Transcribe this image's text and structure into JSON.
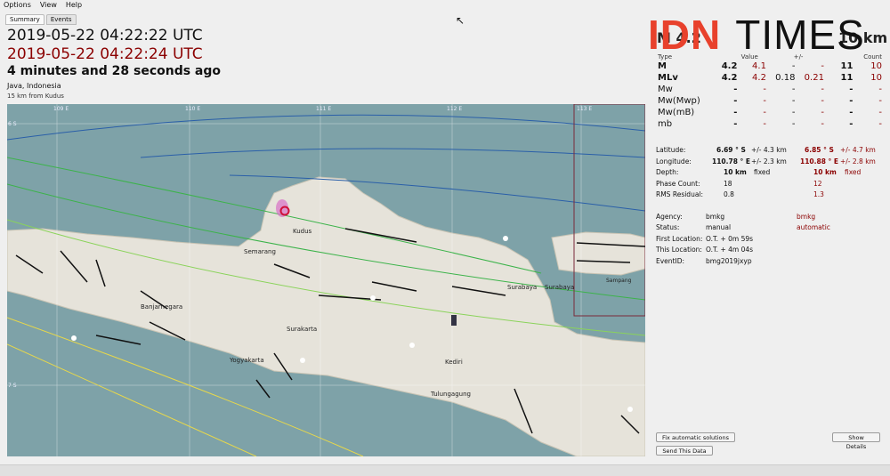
{
  "menu": [
    "Options",
    "View",
    "Help"
  ],
  "tabs": [
    "Summary",
    "Events"
  ],
  "origin_time": "2019-05-22 04:22:22 UTC",
  "current_time": "2019-05-22 04:22:24 UTC",
  "elapsed": "4 minutes and 28 seconds ago",
  "region": "Java, Indonesia",
  "nearest": "15 km from Kudus",
  "logo": {
    "idn": "IDN",
    "times": "TIMES"
  },
  "headline": {
    "mag_partial": "M 4.2",
    "depth_partial": "10 km"
  },
  "mag_table": {
    "headers": [
      "Type",
      "Value",
      "+/-",
      "Count"
    ],
    "rows": [
      {
        "type": "M",
        "value": "4.2",
        "value2": "4.1",
        "err": "-",
        "err2": "-",
        "count": "11",
        "count2": "10"
      },
      {
        "type": "MLv",
        "value": "4.2",
        "value2": "4.2",
        "err": "0.18",
        "err2": "0.21",
        "count": "11",
        "count2": "10"
      },
      {
        "type": "Mw",
        "value": "-",
        "value2": "-",
        "err": "-",
        "err2": "-",
        "count": "-",
        "count2": "-"
      },
      {
        "type": "Mw(Mwp)",
        "value": "-",
        "value2": "-",
        "err": "-",
        "err2": "-",
        "count": "-",
        "count2": "-"
      },
      {
        "type": "Mw(mB)",
        "value": "-",
        "value2": "-",
        "err": "-",
        "err2": "-",
        "count": "-",
        "count2": "-"
      },
      {
        "type": "mb",
        "value": "-",
        "value2": "-",
        "err": "-",
        "err2": "-",
        "count": "-",
        "count2": "-"
      }
    ]
  },
  "info": {
    "latitude": {
      "label": "Latitude:",
      "v1": "6.69 ° S",
      "e1": "+/- 4.3 km",
      "v2": "6.85 ° S",
      "e2": "+/- 4.7 km"
    },
    "longitude": {
      "label": "Longitude:",
      "v1": "110.78 ° E",
      "e1": "+/- 2.3 km",
      "v2": "110.88 ° E",
      "e2": "+/- 2.8 km"
    },
    "depth": {
      "label": "Depth:",
      "v1": "10 km",
      "e1": "fixed",
      "v2": "10 km",
      "e2": "fixed"
    },
    "phase_count": {
      "label": "Phase Count:",
      "v1": "18",
      "v2": "12"
    },
    "rms": {
      "label": "RMS Residual:",
      "v1": "0.8",
      "v2": "1.3"
    },
    "agency": {
      "label": "Agency:",
      "v1": "bmkg",
      "v2": "bmkg"
    },
    "status": {
      "label": "Status:",
      "v1": "manual",
      "v2": "automatic"
    },
    "first_location": {
      "label": "First Location:",
      "v1": "O.T. + 0m 59s"
    },
    "this_location": {
      "label": "This Location:",
      "v1": "O.T. + 4m 04s"
    },
    "event_id": {
      "label": "EventID:",
      "v1": "bmg2019jxyp"
    }
  },
  "buttons": {
    "fix": "Fix automatic solutions",
    "show": "Show Details",
    "send": "Send This Data"
  },
  "map": {
    "lon_labels": [
      "109 E",
      "110 E",
      "111 E",
      "112 E",
      "113 E"
    ],
    "lat_labels": [
      "6 S",
      "7 S"
    ],
    "cities": [
      "Kudus",
      "Semarang",
      "Banjarnegara",
      "Surakarta",
      "Yogyakarta",
      "Kediri",
      "Tulungagung",
      "Surabaya",
      "Surabaya",
      "Sampang"
    ],
    "colors": {
      "sea": "#7ea2a8",
      "land": "#e6e3da",
      "epicenter": "#d0103a",
      "fault": "#111111"
    }
  }
}
